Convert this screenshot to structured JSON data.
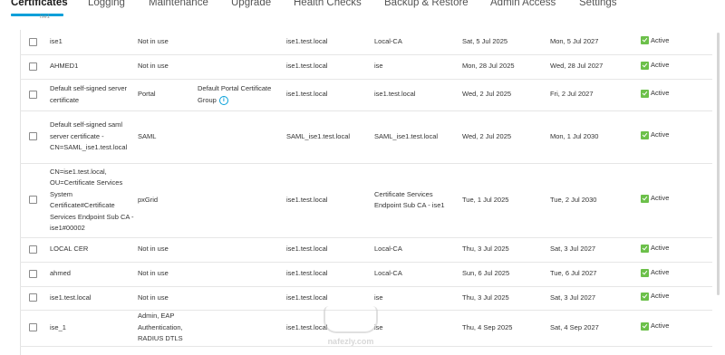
{
  "tabs": [
    "Certificates",
    "Logging",
    "Maintenance",
    "Upgrade",
    "Health Checks",
    "Backup & Restore",
    "Admin Access",
    "Settings"
  ],
  "active_tab": "Certificates",
  "breadcrumb": "ise1",
  "rows": [
    {
      "name": "ise1",
      "used_by": "Not in use",
      "group": "",
      "issued_to": "ise1.test.local",
      "issued_by": "Local-CA",
      "valid_from": "Sat, 5 Jul 2025",
      "expiration": "Mon, 5 Jul 2027",
      "status": "Active"
    },
    {
      "name": "AHMED1",
      "used_by": "Not in use",
      "group": "",
      "issued_to": "ise1.test.local",
      "issued_by": "ise",
      "valid_from": "Mon, 28 Jul 2025",
      "expiration": "Wed, 28 Jul 2027",
      "status": "Active"
    },
    {
      "name": "Default self-signed server certificate",
      "used_by": "Portal",
      "group": "Default Portal Certificate Group",
      "issued_to": "ise1.test.local",
      "issued_by": "ise1.test.local",
      "valid_from": "Wed, 2 Jul 2025",
      "expiration": "Fri, 2 Jul 2027",
      "status": "Active"
    },
    {
      "name": "Default self-signed saml server certificate - CN=SAML_ise1.test.local",
      "used_by": "SAML",
      "group": "",
      "issued_to": "SAML_ise1.test.local",
      "issued_by": "SAML_ise1.test.local",
      "valid_from": "Wed, 2 Jul 2025",
      "expiration": "Mon, 1 Jul 2030",
      "status": "Active"
    },
    {
      "name": "CN=ise1.test.local, OU=Certificate Services System Certificate#Certificate Services Endpoint Sub CA - ise1#00002",
      "used_by": "pxGrid",
      "group": "",
      "issued_to": "ise1.test.local",
      "issued_by": "Certificate Services Endpoint Sub CA - ise1",
      "valid_from": "Tue, 1 Jul 2025",
      "expiration": "Tue, 2 Jul 2030",
      "status": "Active"
    },
    {
      "name": "LOCAL CER",
      "used_by": "Not in use",
      "group": "",
      "issued_to": "ise1.test.local",
      "issued_by": "Local-CA",
      "valid_from": "Thu, 3 Jul 2025",
      "expiration": "Sat, 3 Jul 2027",
      "status": "Active"
    },
    {
      "name": "ahmed",
      "used_by": "Not in use",
      "group": "",
      "issued_to": "ise1.test.local",
      "issued_by": "Local-CA",
      "valid_from": "Sun, 6 Jul 2025",
      "expiration": "Tue, 6 Jul 2027",
      "status": "Active"
    },
    {
      "name": "ise1.test.local",
      "used_by": "Not in use",
      "group": "",
      "issued_to": "ise1.test.local",
      "issued_by": "ise",
      "valid_from": "Thu, 3 Jul 2025",
      "expiration": "Sat, 3 Jul 2027",
      "status": "Active"
    },
    {
      "name": "ise_1",
      "used_by": "Admin, EAP Authentication, RADIUS DTLS",
      "group": "",
      "issued_to": "ise1.test.local",
      "issued_by": "ise",
      "valid_from": "Thu, 4 Sep 2025",
      "expiration": "Sat, 4 Sep 2027",
      "status": "Active"
    }
  ],
  "watermark": {
    "brand": "nafezly.com"
  },
  "colors": {
    "accent": "#049fd9",
    "active_status": "#6cc04a"
  },
  "icons": {
    "status": "check-square-icon",
    "info": "info-circle-icon"
  }
}
